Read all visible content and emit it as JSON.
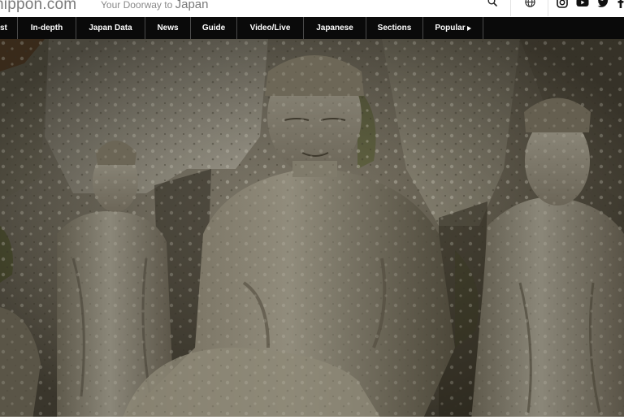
{
  "header": {
    "logo_text": "nippon",
    "logo_suffix": ".com",
    "tagline_prefix": "Your Doorway to",
    "tagline_emph": "Japan",
    "icons": [
      "search-icon",
      "globe-icon",
      "instagram-icon",
      "youtube-icon",
      "twitter-icon",
      "facebook-icon"
    ]
  },
  "nav": {
    "items": [
      {
        "label": "st"
      },
      {
        "label": "In-depth"
      },
      {
        "label": "Japan Data"
      },
      {
        "label": "News"
      },
      {
        "label": "Guide"
      },
      {
        "label": "Video/Live"
      },
      {
        "label": "Japanese"
      },
      {
        "label": "Sections"
      },
      {
        "label": "Popular"
      }
    ]
  },
  "colors": {
    "nav_bg": "#0a0a0a",
    "brand_red": "#c8102e",
    "stone": "#8a8577"
  }
}
